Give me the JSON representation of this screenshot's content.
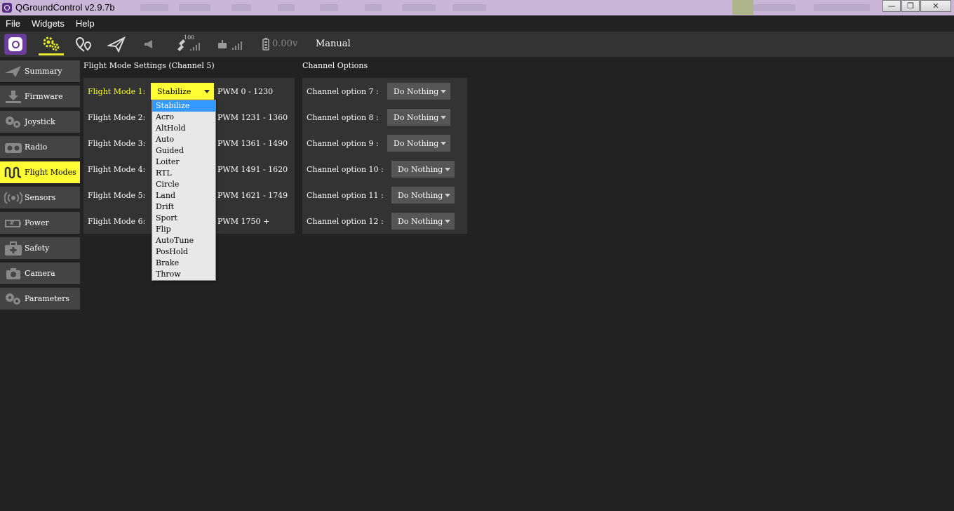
{
  "window": {
    "title": "QGroundControl v2.9.7b",
    "controls": {
      "minimize": "—",
      "maximize": "❐",
      "close": "✕"
    }
  },
  "menu": [
    "File",
    "Widgets",
    "Help"
  ],
  "toolbar": {
    "gps_count": "100",
    "battery": "0.00v",
    "flight_mode": "Manual"
  },
  "sidebar": {
    "items": [
      {
        "label": "Summary",
        "icon": "paper-plane-icon"
      },
      {
        "label": "Firmware",
        "icon": "download-icon"
      },
      {
        "label": "Joystick",
        "icon": "gamepad-icon"
      },
      {
        "label": "Radio",
        "icon": "radio-icon"
      },
      {
        "label": "Flight Modes",
        "icon": "wave-icon",
        "active": true
      },
      {
        "label": "Sensors",
        "icon": "signal-icon"
      },
      {
        "label": "Power",
        "icon": "battery-icon"
      },
      {
        "label": "Safety",
        "icon": "medkit-icon"
      },
      {
        "label": "Camera",
        "icon": "camera-icon"
      },
      {
        "label": "Parameters",
        "icon": "gears-icon"
      }
    ]
  },
  "flight_modes": {
    "title": "Flight Mode Settings (Channel 5)",
    "rows": [
      {
        "label": "Flight Mode 1:",
        "value": "Stabilize",
        "pwm": "PWM 0 - 1230"
      },
      {
        "label": "Flight Mode 2:",
        "value": "",
        "pwm": "PWM 1231 - 1360"
      },
      {
        "label": "Flight Mode 3:",
        "value": "",
        "pwm": "PWM 1361 - 1490"
      },
      {
        "label": "Flight Mode 4:",
        "value": "",
        "pwm": "PWM 1491 - 1620"
      },
      {
        "label": "Flight Mode 5:",
        "value": "",
        "pwm": "PWM 1621 - 1749"
      },
      {
        "label": "Flight Mode 6:",
        "value": "",
        "pwm": "PWM 1750 +"
      }
    ],
    "dropdown_options": [
      "Stabilize",
      "Acro",
      "AltHold",
      "Auto",
      "Guided",
      "Loiter",
      "RTL",
      "Circle",
      "Land",
      "Drift",
      "Sport",
      "Flip",
      "AutoTune",
      "PosHold",
      "Brake",
      "Throw"
    ],
    "dropdown_selected": "Stabilize"
  },
  "channel_options": {
    "title": "Channel Options",
    "rows": [
      {
        "label": "Channel option 7 :",
        "value": "Do Nothing"
      },
      {
        "label": "Channel option 8 :",
        "value": "Do Nothing"
      },
      {
        "label": "Channel option 9 :",
        "value": "Do Nothing"
      },
      {
        "label": "Channel option 10 :",
        "value": "Do Nothing"
      },
      {
        "label": "Channel option 11 :",
        "value": "Do Nothing"
      },
      {
        "label": "Channel option 12 :",
        "value": "Do Nothing"
      }
    ]
  },
  "colors": {
    "accent": "#ffff33",
    "background": "#222222",
    "panel": "#333333",
    "button": "#444444",
    "select_bg": "#555555",
    "dropdown_highlight": "#3399ff"
  }
}
